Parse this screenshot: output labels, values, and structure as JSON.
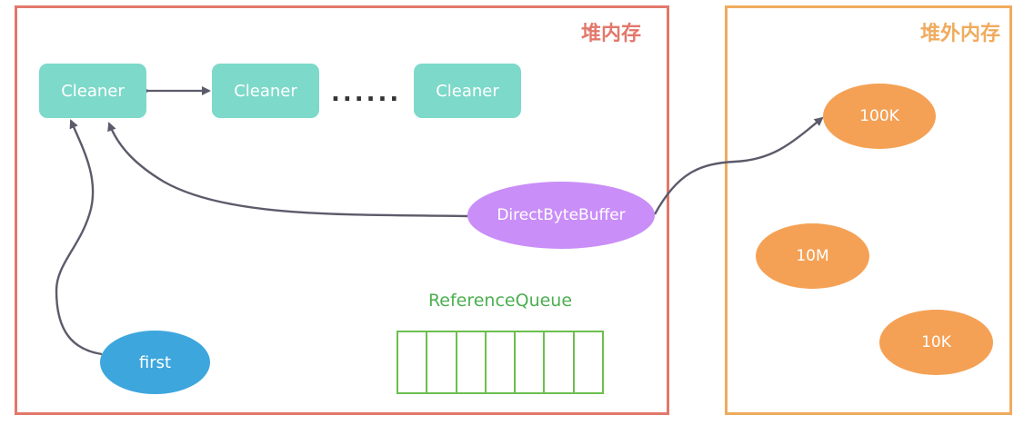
{
  "regions": {
    "heap_title": "堆内存",
    "offheap_title": "堆外内存"
  },
  "cleaners": [
    {
      "label": "Cleaner"
    },
    {
      "label": "Cleaner"
    },
    {
      "label": "Cleaner"
    }
  ],
  "ellipsis": "......",
  "direct_byte_buffer": "DirectByteBuffer",
  "first": "first",
  "reference_queue": {
    "label": "ReferenceQueue",
    "slots": 7
  },
  "offheap_blocks": [
    {
      "label": "100K"
    },
    {
      "label": "10M"
    },
    {
      "label": "10K"
    }
  ],
  "colors": {
    "heap_border": "#e2786b",
    "offheap_border": "#f0ab5e",
    "cleaner": "#7dd9c9",
    "direct_byte_buffer": "#c98ef7",
    "first": "#3da6dd",
    "offheap_block": "#f4a155",
    "reference_queue": "#6bbf4e",
    "arrow": "#5b5b6b"
  }
}
